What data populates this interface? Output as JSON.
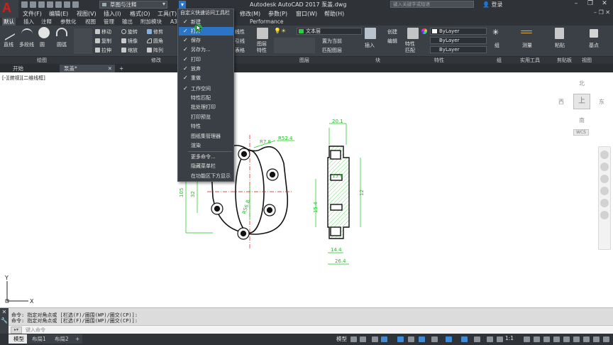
{
  "titlebar": {
    "workspace": "草图与注释",
    "app_title": "Autodesk AutoCAD 2017    泵盖.dwg",
    "search_placeholder": "键入关键字或短语",
    "login": "登录"
  },
  "menubar": [
    "文件(F)",
    "编辑(E)",
    "视图(V)",
    "插入(I)",
    "格式(O)",
    "工具(T)",
    "修改(M)",
    "参数(P)",
    "窗口(W)",
    "帮助(H)"
  ],
  "ribbon_tabs": [
    "默认",
    "插入",
    "注释",
    "参数化",
    "视图",
    "管理",
    "输出",
    "附加模块",
    "A360",
    "Performance"
  ],
  "ribbon": {
    "draw": [
      "直线",
      "多段线",
      "圆",
      "圆弧"
    ],
    "modify": [
      "移动",
      "旋转",
      "修剪",
      "复制",
      "镜像",
      "圆角",
      "拉伸",
      "缩放",
      "阵列"
    ],
    "annot": [
      "线性",
      "引线",
      "表格"
    ],
    "layer_name": "文本层",
    "layer_btns": [
      "置为当前",
      "匹配图层"
    ],
    "layer_props": "图层特性",
    "insert": "插入",
    "block_btns": [
      "创建",
      "编辑"
    ],
    "match_props": "特性匹配",
    "bylayer": [
      "ByLayer",
      "ByLayer",
      "ByLayer"
    ],
    "group": "组",
    "measure": "测量",
    "paste": "粘贴",
    "base": "基点"
  },
  "panel_labels": [
    "绘图",
    "修改",
    "图层",
    "块",
    "特性",
    "组",
    "实用工具",
    "剪贴板",
    "视图"
  ],
  "file_tabs": [
    "开始",
    "泵盖*"
  ],
  "view_label": "[-][俯视][二维线框]",
  "viewcube": {
    "n": "北",
    "s": "南",
    "e": "东",
    "w": "西",
    "top": "上",
    "wcs": "WCS"
  },
  "qat_menu": {
    "title": "自定义快速访问工具栏",
    "items": [
      {
        "label": "新建",
        "checked": true
      },
      {
        "label": "打开",
        "checked": true,
        "hover": true
      },
      {
        "label": "保存",
        "checked": true
      },
      {
        "label": "另存为...",
        "checked": true
      },
      {
        "label": "打印",
        "checked": true
      },
      {
        "label": "放弃",
        "checked": true
      },
      {
        "label": "重做",
        "checked": true
      },
      {
        "label": "工作空间",
        "checked": true
      },
      {
        "label": "特性匹配",
        "checked": false
      },
      {
        "label": "批处理打印",
        "checked": false
      },
      {
        "label": "打印预览",
        "checked": false
      },
      {
        "label": "特性",
        "checked": false
      },
      {
        "label": "图纸集管理器",
        "checked": false
      },
      {
        "label": "渲染",
        "checked": false
      },
      {
        "label": "更多命令...",
        "checked": false
      },
      {
        "label": "隐藏菜单栏",
        "checked": false
      },
      {
        "label": "在功能区下方显示",
        "checked": false
      }
    ]
  },
  "drawing": {
    "dims": [
      "R7.8",
      "R52.4",
      "32",
      "105",
      "R56.8",
      "20.1",
      "15.6",
      "12",
      "15.4",
      "14.4",
      "26.4"
    ]
  },
  "command": {
    "lines": [
      "命令: 指定对角点或 [栏选(F)/圈围(WP)/圈交(CP)]:",
      "命令: 指定对角点或 [栏选(F)/圈围(WP)/圈交(CP)]:"
    ],
    "placeholder": "键入命令"
  },
  "layout_tabs": [
    "模型",
    "布局1",
    "布局2"
  ],
  "status": {
    "model": "模型",
    "scale": "1:1"
  }
}
